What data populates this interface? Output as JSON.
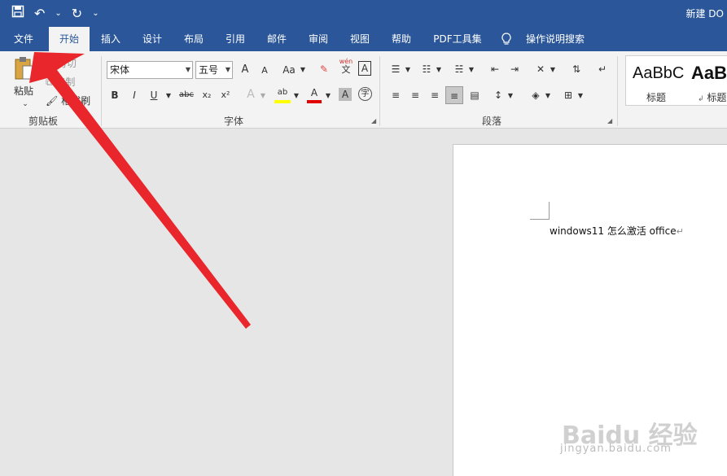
{
  "titlebar": {
    "doc_title": "新建 DO",
    "qat": {
      "save_icon": "save-icon",
      "undo_icon": "undo-icon",
      "redo_icon": "redo-icon",
      "customize_icon": "customize-icon"
    }
  },
  "tabs": [
    {
      "label": "文件"
    },
    {
      "label": "开始"
    },
    {
      "label": "插入"
    },
    {
      "label": "设计"
    },
    {
      "label": "布局"
    },
    {
      "label": "引用"
    },
    {
      "label": "邮件"
    },
    {
      "label": "审阅"
    },
    {
      "label": "视图"
    },
    {
      "label": "帮助"
    },
    {
      "label": "PDF工具集"
    },
    {
      "label": "操作说明搜索"
    }
  ],
  "ribbon": {
    "clipboard": {
      "label": "剪贴板",
      "paste": "粘贴",
      "cut": "剪切",
      "copy": "复制",
      "format_painter": "格式刷"
    },
    "font": {
      "label": "字体",
      "font_name": "宋体",
      "font_size": "五号",
      "grow": "A",
      "shrink": "A",
      "case": "Aa",
      "phonetic": "wén",
      "phonetic_char": "文",
      "border_char": "A",
      "bold": "B",
      "italic": "I",
      "underline": "U",
      "strike": "abc",
      "subscript": "x₂",
      "superscript": "x²",
      "effect": "A",
      "highlight": "ab",
      "font_color": "A",
      "shading": "A",
      "enclose": "字"
    },
    "paragraph": {
      "label": "段落"
    },
    "styles": {
      "sample1": "AaBbC",
      "name1": "标题",
      "sample2": "AaB",
      "name2": "标题"
    }
  },
  "document": {
    "text": "windows11 怎么激活 office"
  },
  "watermark": {
    "text": "Baidu 经验",
    "url": "jingyan.baidu.com"
  },
  "colors": {
    "accent": "#2b579a",
    "arrow": "#e8262b",
    "highlight": "#ffff00",
    "font_color": "#e00000"
  }
}
